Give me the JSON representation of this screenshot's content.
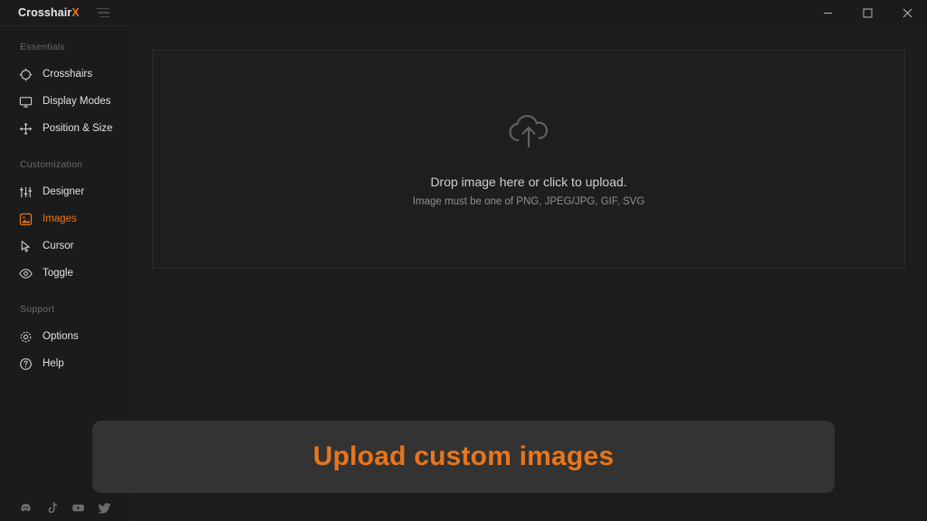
{
  "window": {
    "title_main": "Crosshair",
    "title_accent": "X",
    "menu_icon": "hamburger-menu-icon",
    "controls": {
      "minimize": "minimize-button",
      "maximize": "maximize-button",
      "close": "close-button"
    }
  },
  "sidebar": {
    "sections": [
      {
        "label": "Essentials",
        "items": [
          {
            "label": "Crosshairs",
            "icon": "crosshair-circle-icon",
            "active": false
          },
          {
            "label": "Display Modes",
            "icon": "monitor-icon",
            "active": false
          },
          {
            "label": "Position & Size",
            "icon": "move-arrows-icon",
            "active": false
          }
        ]
      },
      {
        "label": "Customization",
        "items": [
          {
            "label": "Designer",
            "icon": "sliders-icon",
            "active": false
          },
          {
            "label": "Images",
            "icon": "image-icon",
            "active": true
          },
          {
            "label": "Cursor",
            "icon": "cursor-pointer-icon",
            "active": false
          },
          {
            "label": "Toggle",
            "icon": "eye-icon",
            "active": false
          }
        ]
      },
      {
        "label": "Support",
        "items": [
          {
            "label": "Options",
            "icon": "gear-icon",
            "active": false
          },
          {
            "label": "Help",
            "icon": "help-circle-icon",
            "active": false
          }
        ]
      }
    ],
    "socials": [
      {
        "name": "discord-icon"
      },
      {
        "name": "tiktok-icon"
      },
      {
        "name": "youtube-icon"
      },
      {
        "name": "twitter-icon"
      }
    ]
  },
  "main": {
    "dropzone": {
      "icon": "cloud-upload-icon",
      "title": "Drop image here or click to upload.",
      "subtitle": "Image must be one of PNG, JPEG/JPG, GIF, SVG"
    }
  },
  "caption": {
    "text": "Upload custom images"
  },
  "colors": {
    "accent": "#e8761c",
    "window_bg": "#1c1c1c",
    "sidebar_bg": "#1b1b1b",
    "dropzone_bg": "#1e1e1e",
    "caption_bg": "#333333"
  }
}
